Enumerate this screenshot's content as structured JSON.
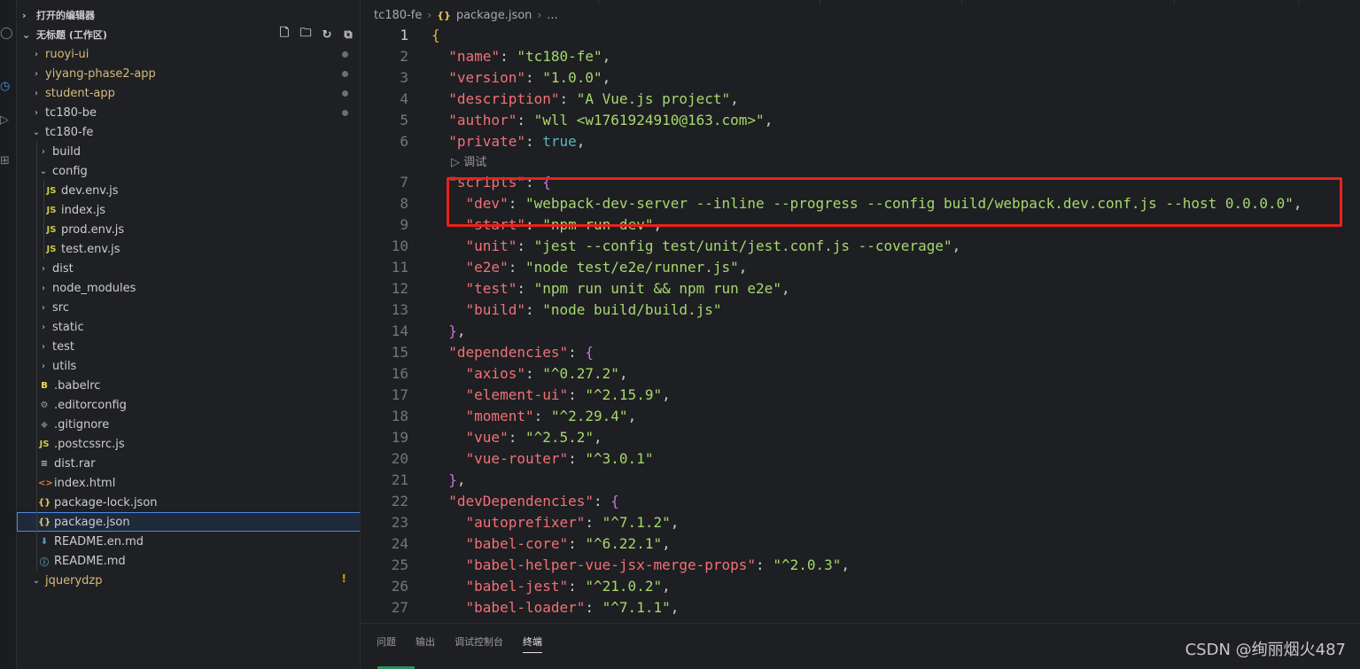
{
  "explorer": {
    "open_editors_label": "打开的编辑器",
    "workspace_label": "无标题 (工作区)",
    "actions": [
      {
        "name": "new-file-icon",
        "glyph": "🗋"
      },
      {
        "name": "new-folder-icon",
        "glyph": "🗀"
      },
      {
        "name": "refresh-icon",
        "glyph": "↻"
      },
      {
        "name": "collapse-all-icon",
        "glyph": "⧉"
      }
    ],
    "rows": [
      {
        "label": "ruoyi-ui",
        "depth": 0,
        "kind": "folder",
        "expanded": false,
        "modified": true,
        "dot": true
      },
      {
        "label": "yiyang-phase2-app",
        "depth": 0,
        "kind": "folder",
        "expanded": false,
        "modified": true,
        "dot": true
      },
      {
        "label": "student-app",
        "depth": 0,
        "kind": "folder",
        "expanded": false,
        "modified": true,
        "dot": true
      },
      {
        "label": "tc180-be",
        "depth": 0,
        "kind": "folder",
        "expanded": false,
        "modified": false,
        "dot": true
      },
      {
        "label": "tc180-fe",
        "depth": 0,
        "kind": "folder",
        "expanded": true,
        "modified": false
      },
      {
        "label": "build",
        "depth": 1,
        "kind": "folder",
        "expanded": false
      },
      {
        "label": "config",
        "depth": 1,
        "kind": "folder",
        "expanded": true
      },
      {
        "label": "dev.env.js",
        "depth": 2,
        "kind": "js"
      },
      {
        "label": "index.js",
        "depth": 2,
        "kind": "js"
      },
      {
        "label": "prod.env.js",
        "depth": 2,
        "kind": "js"
      },
      {
        "label": "test.env.js",
        "depth": 2,
        "kind": "js"
      },
      {
        "label": "dist",
        "depth": 1,
        "kind": "folder",
        "expanded": false
      },
      {
        "label": "node_modules",
        "depth": 1,
        "kind": "folder",
        "expanded": false
      },
      {
        "label": "src",
        "depth": 1,
        "kind": "folder",
        "expanded": false
      },
      {
        "label": "static",
        "depth": 1,
        "kind": "folder",
        "expanded": false
      },
      {
        "label": "test",
        "depth": 1,
        "kind": "folder",
        "expanded": false
      },
      {
        "label": "utils",
        "depth": 1,
        "kind": "folder",
        "expanded": false
      },
      {
        "label": ".babelrc",
        "depth": 1,
        "kind": "babel"
      },
      {
        "label": ".editorconfig",
        "depth": 1,
        "kind": "gear"
      },
      {
        "label": ".gitignore",
        "depth": 1,
        "kind": "git"
      },
      {
        "label": ".postcssrc.js",
        "depth": 1,
        "kind": "js"
      },
      {
        "label": "dist.rar",
        "depth": 1,
        "kind": "text"
      },
      {
        "label": "index.html",
        "depth": 1,
        "kind": "html"
      },
      {
        "label": "package-lock.json",
        "depth": 1,
        "kind": "json"
      },
      {
        "label": "package.json",
        "depth": 1,
        "kind": "json",
        "selected": true
      },
      {
        "label": "README.en.md",
        "depth": 1,
        "kind": "md"
      },
      {
        "label": "README.md",
        "depth": 1,
        "kind": "info"
      },
      {
        "label": "jquerydzp",
        "depth": 0,
        "kind": "folder",
        "expanded": true,
        "modified": true,
        "warning": "!"
      }
    ]
  },
  "breadcrumb": {
    "folder": "tc180-fe",
    "file": "package.json",
    "more": "..."
  },
  "editor": {
    "codelens_label": "调试",
    "codelens_after_line": 6,
    "active_line": 1,
    "lines": [
      {
        "n": 1,
        "tokens": [
          [
            "{",
            "b"
          ]
        ]
      },
      {
        "n": 2,
        "tokens": [
          [
            "  "
          ],
          [
            "\"name\"",
            "k"
          ],
          [
            ": "
          ],
          [
            "\"tc180-fe\"",
            "s"
          ],
          [
            ","
          ]
        ]
      },
      {
        "n": 3,
        "tokens": [
          [
            "  "
          ],
          [
            "\"version\"",
            "k"
          ],
          [
            ": "
          ],
          [
            "\"1.0.0\"",
            "s"
          ],
          [
            ","
          ]
        ]
      },
      {
        "n": 4,
        "tokens": [
          [
            "  "
          ],
          [
            "\"description\"",
            "k"
          ],
          [
            ": "
          ],
          [
            "\"A Vue.js project\"",
            "s"
          ],
          [
            ","
          ]
        ]
      },
      {
        "n": 5,
        "tokens": [
          [
            "  "
          ],
          [
            "\"author\"",
            "k"
          ],
          [
            ": "
          ],
          [
            "\"wll <w1761924910@163.com>\"",
            "s"
          ],
          [
            ","
          ]
        ]
      },
      {
        "n": 6,
        "tokens": [
          [
            "  "
          ],
          [
            "\"private\"",
            "k"
          ],
          [
            ": "
          ],
          [
            "true",
            "bool"
          ],
          [
            ","
          ]
        ]
      },
      {
        "n": 7,
        "tokens": [
          [
            "  "
          ],
          [
            "\"scripts\"",
            "k"
          ],
          [
            ": "
          ],
          [
            "{",
            "bp"
          ]
        ]
      },
      {
        "n": 8,
        "tokens": [
          [
            "    "
          ],
          [
            "\"dev\"",
            "k"
          ],
          [
            ": "
          ],
          [
            "\"webpack-dev-server --inline --progress --config build/webpack.dev.conf.js --host 0.0.0.0\"",
            "s"
          ],
          [
            ","
          ]
        ]
      },
      {
        "n": 9,
        "tokens": [
          [
            "    "
          ],
          [
            "\"start\"",
            "k"
          ],
          [
            ": "
          ],
          [
            "\"npm run dev\"",
            "s"
          ],
          [
            ","
          ]
        ]
      },
      {
        "n": 10,
        "tokens": [
          [
            "    "
          ],
          [
            "\"unit\"",
            "k"
          ],
          [
            ": "
          ],
          [
            "\"jest --config test/unit/jest.conf.js --coverage\"",
            "s"
          ],
          [
            ","
          ]
        ]
      },
      {
        "n": 11,
        "tokens": [
          [
            "    "
          ],
          [
            "\"e2e\"",
            "k"
          ],
          [
            ": "
          ],
          [
            "\"node test/e2e/runner.js\"",
            "s"
          ],
          [
            ","
          ]
        ]
      },
      {
        "n": 12,
        "tokens": [
          [
            "    "
          ],
          [
            "\"test\"",
            "k"
          ],
          [
            ": "
          ],
          [
            "\"npm run unit && npm run e2e\"",
            "s"
          ],
          [
            ","
          ]
        ]
      },
      {
        "n": 13,
        "tokens": [
          [
            "    "
          ],
          [
            "\"build\"",
            "k"
          ],
          [
            ": "
          ],
          [
            "\"node build/build.js\"",
            "s"
          ]
        ]
      },
      {
        "n": 14,
        "tokens": [
          [
            "  "
          ],
          [
            "}",
            "bp"
          ],
          [
            ","
          ]
        ]
      },
      {
        "n": 15,
        "tokens": [
          [
            "  "
          ],
          [
            "\"dependencies\"",
            "k"
          ],
          [
            ": "
          ],
          [
            "{",
            "bp"
          ]
        ]
      },
      {
        "n": 16,
        "tokens": [
          [
            "    "
          ],
          [
            "\"axios\"",
            "k"
          ],
          [
            ": "
          ],
          [
            "\"^0.27.2\"",
            "s"
          ],
          [
            ","
          ]
        ]
      },
      {
        "n": 17,
        "tokens": [
          [
            "    "
          ],
          [
            "\"element-ui\"",
            "k"
          ],
          [
            ": "
          ],
          [
            "\"^2.15.9\"",
            "s"
          ],
          [
            ","
          ]
        ]
      },
      {
        "n": 18,
        "tokens": [
          [
            "    "
          ],
          [
            "\"moment\"",
            "k"
          ],
          [
            ": "
          ],
          [
            "\"^2.29.4\"",
            "s"
          ],
          [
            ","
          ]
        ]
      },
      {
        "n": 19,
        "tokens": [
          [
            "    "
          ],
          [
            "\"vue\"",
            "k"
          ],
          [
            ": "
          ],
          [
            "\"^2.5.2\"",
            "s"
          ],
          [
            ","
          ]
        ]
      },
      {
        "n": 20,
        "tokens": [
          [
            "    "
          ],
          [
            "\"vue-router\"",
            "k"
          ],
          [
            ": "
          ],
          [
            "\"^3.0.1\"",
            "s"
          ]
        ]
      },
      {
        "n": 21,
        "tokens": [
          [
            "  "
          ],
          [
            "}",
            "bp"
          ],
          [
            ","
          ]
        ]
      },
      {
        "n": 22,
        "tokens": [
          [
            "  "
          ],
          [
            "\"devDependencies\"",
            "k"
          ],
          [
            ": "
          ],
          [
            "{",
            "bp"
          ]
        ]
      },
      {
        "n": 23,
        "tokens": [
          [
            "    "
          ],
          [
            "\"autoprefixer\"",
            "k"
          ],
          [
            ": "
          ],
          [
            "\"^7.1.2\"",
            "s"
          ],
          [
            ","
          ]
        ]
      },
      {
        "n": 24,
        "tokens": [
          [
            "    "
          ],
          [
            "\"babel-core\"",
            "k"
          ],
          [
            ": "
          ],
          [
            "\"^6.22.1\"",
            "s"
          ],
          [
            ","
          ]
        ]
      },
      {
        "n": 25,
        "tokens": [
          [
            "    "
          ],
          [
            "\"babel-helper-vue-jsx-merge-props\"",
            "k"
          ],
          [
            ": "
          ],
          [
            "\"^2.0.3\"",
            "s"
          ],
          [
            ","
          ]
        ]
      },
      {
        "n": 26,
        "tokens": [
          [
            "    "
          ],
          [
            "\"babel-jest\"",
            "k"
          ],
          [
            ": "
          ],
          [
            "\"^21.0.2\"",
            "s"
          ],
          [
            ","
          ]
        ]
      },
      {
        "n": 27,
        "tokens": [
          [
            "    "
          ],
          [
            "\"babel-loader\"",
            "k"
          ],
          [
            ": "
          ],
          [
            "\"^7.1.1\"",
            "s"
          ],
          [
            ","
          ]
        ]
      }
    ]
  },
  "panel": {
    "tabs": [
      {
        "label": "问题",
        "active": false
      },
      {
        "label": "输出",
        "active": false
      },
      {
        "label": "调试控制台",
        "active": false
      },
      {
        "label": "终端",
        "active": true
      }
    ]
  },
  "watermark": "CSDN @绚丽烟火487",
  "colors": {
    "highlight_box": "#e8231b",
    "selection_outline": "#4d8ae6",
    "json_key": "#f07178",
    "json_string": "#a5d86e",
    "json_bool": "#56b6c2",
    "git_modified": "#d7ba7d"
  }
}
